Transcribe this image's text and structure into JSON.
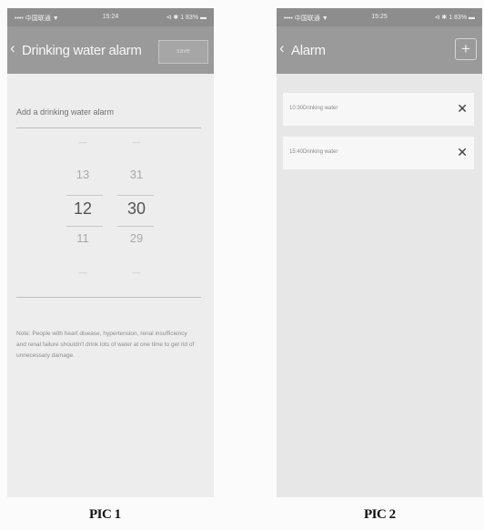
{
  "pic1": {
    "status": {
      "left": "•••• 中国联通 ▼",
      "time": "15:24",
      "right": "⊲ ✱ 1 83% ▬"
    },
    "back_icon": "‹",
    "title": "Drinking water alarm",
    "save_label": "save",
    "add_label": "Add a  drinking water alarm",
    "picker": {
      "hours": {
        "far": "—",
        "near1": "13",
        "selected": "12",
        "near2": "11",
        "far2": "—"
      },
      "minutes": {
        "far": "—",
        "near1": "31",
        "selected": "30",
        "near2": "29",
        "far2": "—"
      }
    },
    "note": "Note: People with heart disease, hypertension, renal insufficiency and renal failure shouldn't drink lots of water at one time to get rid of unnecessary damage."
  },
  "pic2": {
    "status": {
      "left": "•••• 中国联通 ▼",
      "time": "15:25",
      "right": "⊲ ✱ 1 83% ▬"
    },
    "back_icon": "‹",
    "title": "Alarm",
    "add_icon": "+",
    "alarms": [
      {
        "text": "10:30Drinking water",
        "delete_icon": "✕"
      },
      {
        "text": "15:40Drinking water",
        "delete_icon": "✕"
      }
    ]
  },
  "captions": {
    "pic1": "PIC 1",
    "pic2": "PIC 2"
  }
}
